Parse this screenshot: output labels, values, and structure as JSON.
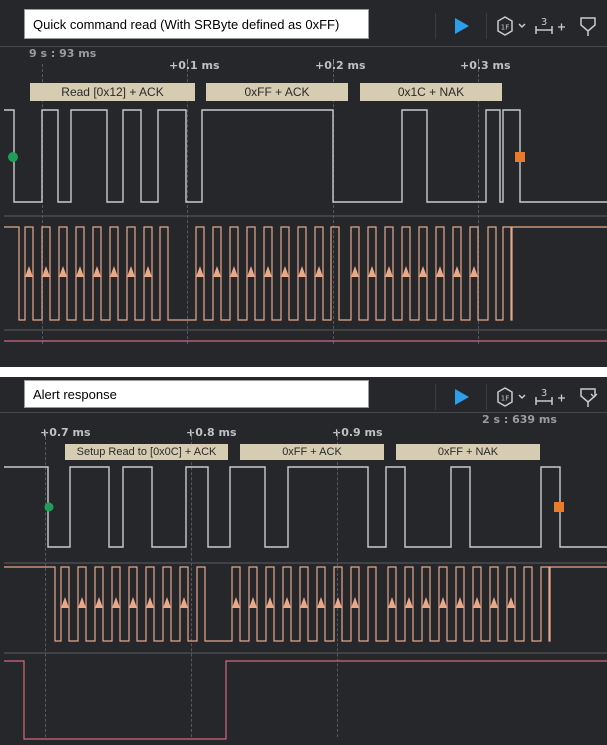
{
  "panels": [
    {
      "caption": "Quick command read (With SRByte defined as 0xFF)",
      "cursor_time": "9 s : 93 ms",
      "time_labels": [
        "+0.1 ms",
        "+0.2 ms",
        "+0.3 ms"
      ],
      "decodes": [
        "Read [0x12] + ACK",
        "0xFF + ACK",
        "0x1C + NAK"
      ]
    },
    {
      "caption": "Alert response",
      "cursor_time": "2 s : 639 ms",
      "time_labels": [
        "+0.7 ms",
        "+0.8 ms",
        "+0.9 ms"
      ],
      "decodes": [
        "Setup Read to [0x0C] + ACK",
        "0xFF + ACK",
        "0xFF + NAK"
      ]
    }
  ],
  "toolbar": {
    "play_icon": "play-icon",
    "trigger_icon": "trigger-settings-icon",
    "measure_icon": "measure-icon",
    "measure_number": "3",
    "marker_icon": "marker-icon"
  },
  "colors": {
    "sda": "#c9cacc",
    "scl": "#e8a88a",
    "third": "#d4677d",
    "start_marker": "#1e9f55",
    "stop_marker": "#ea7a2c",
    "play": "#2d9ee8",
    "decode_bg": "#d5ccb2"
  }
}
